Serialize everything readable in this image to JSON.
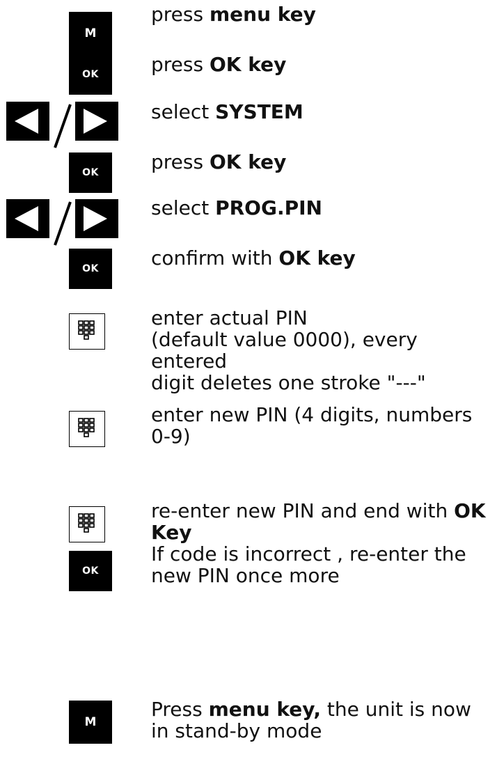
{
  "icons": {
    "menu_key": "M",
    "ok_key": "OK",
    "arrow_left": "left-arrow-key-icon",
    "arrow_right": "right-arrow-key-icon",
    "separator": "/",
    "keypad": "numeric-keypad-icon"
  },
  "steps": [
    {
      "pre": "press ",
      "bold": "menu key",
      "post": ""
    },
    {
      "pre": "press ",
      "bold": "OK key",
      "post": ""
    },
    {
      "pre": "select ",
      "bold": "SYSTEM",
      "post": ""
    },
    {
      "pre": "press ",
      "bold": "OK key",
      "post": ""
    },
    {
      "pre": "select ",
      "bold": "PROG.PIN",
      "post": ""
    },
    {
      "pre": "confirm with ",
      "bold": "OK key",
      "post": ""
    },
    {
      "pre": "enter actual PIN\n(default value 0000), every entered\ndigit deletes one stroke \"---\"",
      "bold": "",
      "post": ""
    },
    {
      "pre": "enter new PIN (4 digits, numbers\n0-9)",
      "bold": "",
      "post": ""
    },
    {
      "pre": "re-enter new PIN and end with ",
      "bold": "OK\nKey",
      "post": "\nIf code is incorrect , re-enter the\nnew PIN once more"
    },
    {
      "pre": "Press ",
      "bold": "menu key,",
      "post": " the unit is now\nin stand-by mode"
    }
  ]
}
